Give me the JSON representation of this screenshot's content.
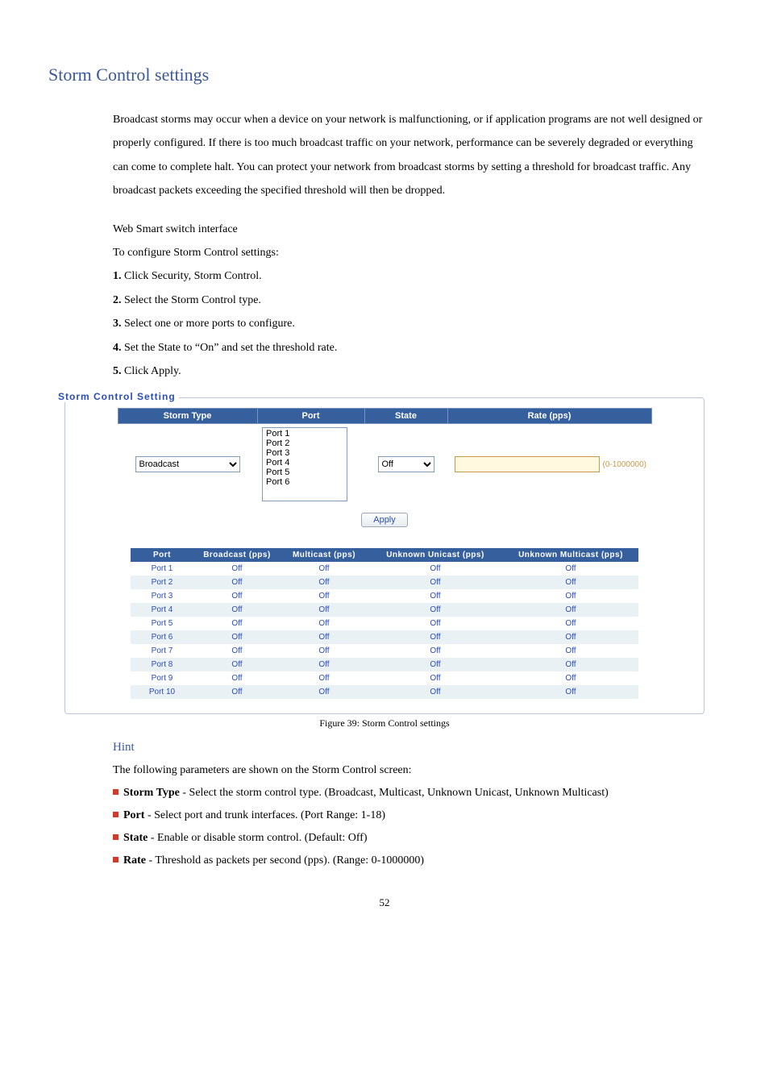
{
  "page": {
    "title": "Storm Control settings",
    "intro": "Broadcast storms may occur when a device on your network is malfunctioning, or if application programs are not well designed or properly configured. If there is too much broadcast traffic on your network, performance can be severely degraded or everything can come to complete halt. You can protect your network from broadcast storms by setting a threshold for broadcast traffic. Any broadcast packets exceeding the specified threshold will then be dropped.",
    "interface_line": "Web Smart switch interface",
    "config_line": "To configure Storm Control settings:",
    "steps": {
      "s1_num": "1.",
      "s1_txt": " Click Security, Storm Control.",
      "s2_num": "2.",
      "s2_txt": " Select the Storm Control type.",
      "s3_num": "3.",
      "s3_txt": " Select one or more ports to configure.",
      "s4_num": "4.",
      "s4_txt": " Set the State to “On” and set the threshold rate.",
      "s5_num": "5.",
      "s5_txt": " Click Apply."
    }
  },
  "panel": {
    "legend": "Storm Control Setting",
    "headers": {
      "storm_type": "Storm Type",
      "port": "Port",
      "state": "State",
      "rate": "Rate (pps)"
    },
    "storm_type_value": "Broadcast",
    "ports": [
      "Port 1",
      "Port 2",
      "Port 3",
      "Port 4",
      "Port 5",
      "Port 6"
    ],
    "state_value": "Off",
    "rate_value": "",
    "rate_hint": "(0-1000000)",
    "apply_label": "Apply"
  },
  "status": {
    "headers": {
      "port": "Port",
      "bc": "Broadcast (pps)",
      "mc": "Multicast (pps)",
      "uu": "Unknown Unicast (pps)",
      "um": "Unknown Multicast (pps)"
    },
    "rows": [
      {
        "port": "Port 1",
        "bc": "Off",
        "mc": "Off",
        "uu": "Off",
        "um": "Off"
      },
      {
        "port": "Port 2",
        "bc": "Off",
        "mc": "Off",
        "uu": "Off",
        "um": "Off"
      },
      {
        "port": "Port 3",
        "bc": "Off",
        "mc": "Off",
        "uu": "Off",
        "um": "Off"
      },
      {
        "port": "Port 4",
        "bc": "Off",
        "mc": "Off",
        "uu": "Off",
        "um": "Off"
      },
      {
        "port": "Port 5",
        "bc": "Off",
        "mc": "Off",
        "uu": "Off",
        "um": "Off"
      },
      {
        "port": "Port 6",
        "bc": "Off",
        "mc": "Off",
        "uu": "Off",
        "um": "Off"
      },
      {
        "port": "Port 7",
        "bc": "Off",
        "mc": "Off",
        "uu": "Off",
        "um": "Off"
      },
      {
        "port": "Port 8",
        "bc": "Off",
        "mc": "Off",
        "uu": "Off",
        "um": "Off"
      },
      {
        "port": "Port 9",
        "bc": "Off",
        "mc": "Off",
        "uu": "Off",
        "um": "Off"
      },
      {
        "port": "Port 10",
        "bc": "Off",
        "mc": "Off",
        "uu": "Off",
        "um": "Off"
      }
    ],
    "caption": "Figure 39: Storm Control settings"
  },
  "hint": {
    "heading": "Hint",
    "intro": "The following parameters are shown on the Storm Control screen:",
    "items": {
      "i1_b": "Storm Type",
      "i1_t": " - Select the storm control type. (Broadcast, Multicast, Unknown Unicast, Unknown Multicast)",
      "i2_b": "Port",
      "i2_t": " - Select port and trunk interfaces. (Port Range: 1-18)",
      "i3_b": "State",
      "i3_t": " - Enable or disable storm control. (Default: Off)",
      "i4_b": "Rate",
      "i4_t": " - Threshold as packets per second (pps). (Range: 0-1000000)"
    }
  },
  "pagenum": "52"
}
